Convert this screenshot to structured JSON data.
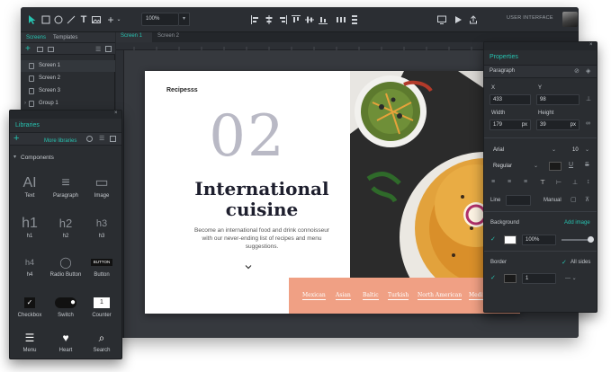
{
  "toolbar": {
    "zoom": "100%",
    "right_label": "USER INTERFACE"
  },
  "screens_panel": {
    "tabs": [
      "Screens",
      "Templates"
    ],
    "items": [
      "Screen 1",
      "Screen 2",
      "Screen 3",
      "Group 1"
    ]
  },
  "canvas": {
    "tabs": [
      "Screen 1",
      "Screen 2"
    ]
  },
  "artboard": {
    "logo": "Recipesss",
    "number": "02",
    "headline_line1": "International",
    "headline_line2": "cuisine",
    "body": "Become an international food and drink connoisseur with our never-ending list of recipes and menu suggestions.",
    "food_tags": [
      "Mexican",
      "Asian",
      "Baltic",
      "Turkish",
      "North American",
      "Mediterranean"
    ]
  },
  "libraries": {
    "title": "Libraries",
    "more": "More libraries",
    "section": "Components",
    "items": [
      {
        "label": "Text",
        "glyph": "AI"
      },
      {
        "label": "Paragraph",
        "glyph": "≡"
      },
      {
        "label": "Image",
        "glyph": "▭"
      },
      {
        "label": "h1",
        "glyph": "h1"
      },
      {
        "label": "h2",
        "glyph": "h2"
      },
      {
        "label": "h3",
        "glyph": "h3"
      },
      {
        "label": "h4",
        "glyph": "h4"
      },
      {
        "label": "Radio Button",
        "glyph": "◯"
      },
      {
        "label": "Button",
        "glyph": "BUTTON"
      },
      {
        "label": "Checkbox",
        "glyph": "✓"
      },
      {
        "label": "Switch",
        "glyph": "●"
      },
      {
        "label": "Counter",
        "glyph": "1"
      },
      {
        "label": "Menu",
        "glyph": "☰"
      },
      {
        "label": "Heart",
        "glyph": "♥"
      },
      {
        "label": "Search",
        "glyph": "⌕"
      }
    ]
  },
  "properties": {
    "title": "Properties",
    "element": "Paragraph",
    "x_label": "X",
    "x": "433",
    "y_label": "Y",
    "y": "98",
    "width_label": "Width",
    "width": "179",
    "width_unit": "px",
    "height_label": "Height",
    "height": "39",
    "height_unit": "px",
    "font": "Arial",
    "font_size": "10",
    "font_style": "Regular",
    "line_label": "Line",
    "manual_label": "Manual",
    "background_label": "Background",
    "add_image": "Add image",
    "background_opacity": "100%",
    "border_label": "Border",
    "all_sides": "All sides",
    "border_width": "1"
  },
  "colors": {
    "accent": "#27c2b0",
    "panel": "#2a2d31",
    "strip": "#f0a084"
  }
}
